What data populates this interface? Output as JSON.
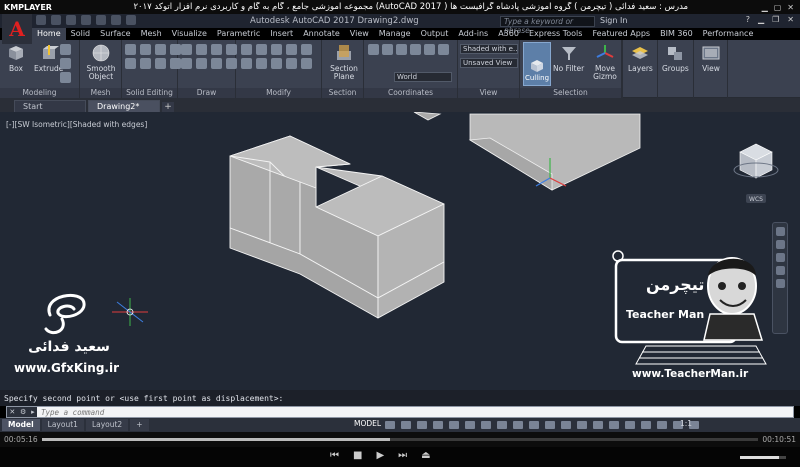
{
  "player": {
    "logo": "KMPLAYER",
    "caption": "مجموعه آموزشی جامع ، گام به گام و کاربردی نرم افزار  اتوکد ۲۰۱۷ (AutoCAD 2017 )   مدرس : سعید فدائی ( تیچرمن ) گروه آموزشی پادشاه گرافیست ها",
    "time_elapsed": "00:05:16",
    "time_total": "00:10:51",
    "progress_fraction": 0.486,
    "volume_fraction": 0.85
  },
  "acad": {
    "title": "Autodesk AutoCAD 2017    Drawing2.dwg",
    "search_placeholder": "Type a keyword or phrase",
    "sign_in": "Sign In",
    "app_letter": "A"
  },
  "ribbon_tabs": [
    "Home",
    "Solid",
    "Surface",
    "Mesh",
    "Visualize",
    "Parametric",
    "Insert",
    "Annotate",
    "View",
    "Manage",
    "Output",
    "Add-ins",
    "A360",
    "Express Tools",
    "Featured Apps",
    "BIM 360",
    "Performance"
  ],
  "ribbon": {
    "box": "Box",
    "extrude": "Extrude",
    "smooth_object": "Smooth Object",
    "section_plane": "Section Plane",
    "visual_style": "Shaded with e...",
    "view_state": "Unsaved View",
    "ucs": "World",
    "culling": "Culling",
    "no_filter": "No Filter",
    "move_gizmo": "Move Gizmo",
    "layers": "Layers",
    "groups": "Groups",
    "view": "View",
    "panels": {
      "modeling": "Modeling",
      "mesh": "Mesh",
      "solid_editing": "Solid Editing",
      "draw": "Draw",
      "modify": "Modify",
      "section": "Section",
      "coordinates": "Coordinates",
      "view": "View",
      "selection": "Selection"
    }
  },
  "doc_tabs": {
    "start": "Start",
    "drawing": "Drawing2*"
  },
  "viewport": {
    "label": "[-][SW Isometric][Shaded with edges]",
    "wcs": "WCS",
    "viewcube_face": "FRONT"
  },
  "command": {
    "history": "Specify second point or <use first point as displacement>:",
    "placeholder": "Type a command"
  },
  "status": {
    "layout_tabs": [
      "Model",
      "Layout1",
      "Layout2"
    ],
    "model": "MODEL",
    "scale": "1:1"
  },
  "watermarks": {
    "teacher_logo_text": "تیچرمن",
    "teacher_name": "Teacher Man",
    "teacher_url": "www.TeacherMan.ir",
    "sign_name": "سعید فدائی",
    "gfx_url": "www.GfxKing.ir"
  },
  "colors": {
    "ribbon_bg": "#3b4150",
    "canvas_bg": "#212834",
    "solid_top": "#bcbcbc",
    "solid_left": "#a9a9a9",
    "solid_right": "#b4b4b4",
    "accent_red": "#e02020"
  }
}
